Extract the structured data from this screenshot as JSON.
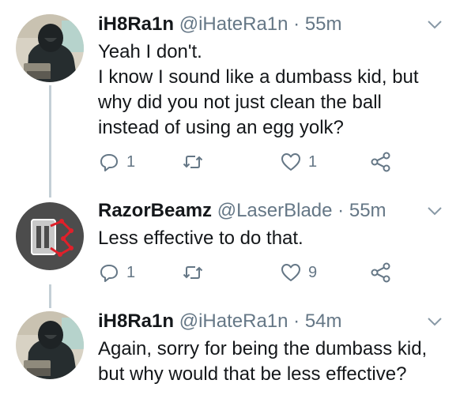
{
  "tweets": [
    {
      "name": "iH8Ra1n",
      "handle": "@iHateRa1n",
      "dot": "·",
      "time": "55m",
      "lines": [
        "Yeah I don't.",
        "I know I sound like a dumbass kid, but",
        "why did you not just clean the ball",
        "instead of using an egg yolk?"
      ],
      "reply_count": "1",
      "retweet_count": "",
      "like_count": "1",
      "avatar": "hooded-figure-avatar"
    },
    {
      "name": "RazorBeamz",
      "handle": "@LaserBlade",
      "dot": "·",
      "time": "55m",
      "lines": [
        "Less effective to do that."
      ],
      "reply_count": "1",
      "retweet_count": "",
      "like_count": "9",
      "avatar": "razor-blade-logo-avatar"
    },
    {
      "name": "iH8Ra1n",
      "handle": "@iHateRa1n",
      "dot": "·",
      "time": "54m",
      "lines": [
        "Again, sorry for being the dumbass kid,",
        "but why would that be less effective?"
      ],
      "avatar": "hooded-figure-avatar"
    }
  ],
  "colors": {
    "text": "#14171a",
    "secondary": "#657786",
    "thread_line": "#c4cfd6"
  },
  "icons": [
    "reply-icon",
    "retweet-icon",
    "like-icon",
    "share-icon",
    "chevron-down-icon"
  ]
}
